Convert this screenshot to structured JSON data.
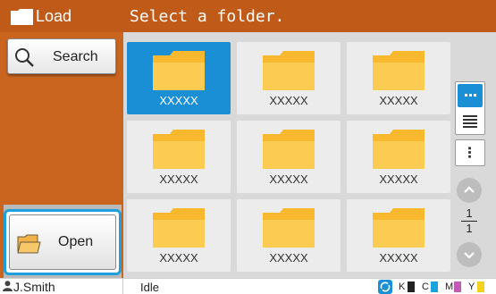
{
  "sidebar": {
    "title": "Load",
    "search_label": "Search",
    "open_label": "Open"
  },
  "main": {
    "prompt": "Select a folder.",
    "folders": [
      {
        "label": "XXXXX",
        "selected": true
      },
      {
        "label": "XXXXX",
        "selected": false
      },
      {
        "label": "XXXXX",
        "selected": false
      },
      {
        "label": "XXXXX",
        "selected": false
      },
      {
        "label": "XXXXX",
        "selected": false
      },
      {
        "label": "XXXXX",
        "selected": false
      },
      {
        "label": "XXXXX",
        "selected": false
      },
      {
        "label": "XXXXX",
        "selected": false
      },
      {
        "label": "XXXXX",
        "selected": false
      }
    ]
  },
  "pager": {
    "current": "1",
    "total": "1"
  },
  "view_controls": {
    "tile_view_icon": "grid-view-icon",
    "list_view_icon": "list-view-icon",
    "menu_icon": "more-vertical-icon"
  },
  "status": {
    "user": "J.Smith",
    "state": "Idle",
    "inks": [
      {
        "label": "K",
        "color": "#222222"
      },
      {
        "label": "C",
        "color": "#1aa3e0"
      },
      {
        "label": "M",
        "color": "#c25bb5"
      },
      {
        "label": "Y",
        "color": "#f2d21a"
      }
    ]
  },
  "colors": {
    "accent": "#1a8fd6",
    "header": "#bf5a19",
    "sidebar": "#c9651f",
    "folder": "#f8b92e"
  }
}
